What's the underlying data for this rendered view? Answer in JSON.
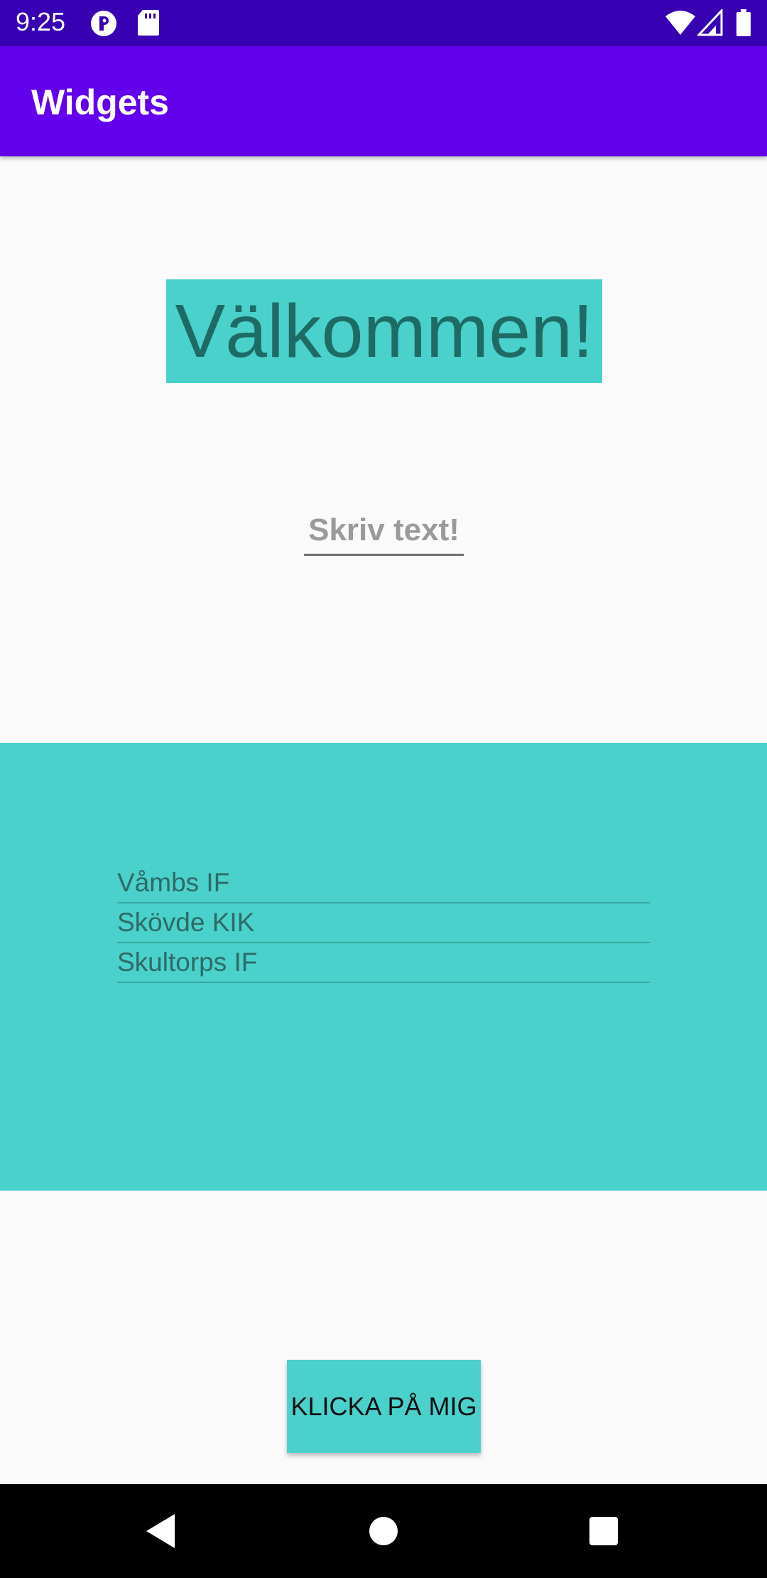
{
  "status_bar": {
    "time": "9:25",
    "icons": [
      "circle-p-icon",
      "sd-card-icon",
      "wifi-icon",
      "signal-icon",
      "battery-icon"
    ]
  },
  "app_bar": {
    "title": "Widgets"
  },
  "welcome": {
    "text": "Välkommen!"
  },
  "input": {
    "placeholder": "Skriv text!",
    "value": ""
  },
  "list": {
    "items": [
      "Våmbs IF",
      "Skövde KIK",
      "Skultorps IF"
    ]
  },
  "button": {
    "label": "KLICKA PÅ MIG"
  },
  "nav_bar": {
    "icons": [
      "back-icon",
      "home-icon",
      "recents-icon"
    ]
  },
  "colors": {
    "status_bar": "#3700b3",
    "app_bar": "#6200ee",
    "accent_teal": "#4ad1cb",
    "background": "#fafafa"
  }
}
